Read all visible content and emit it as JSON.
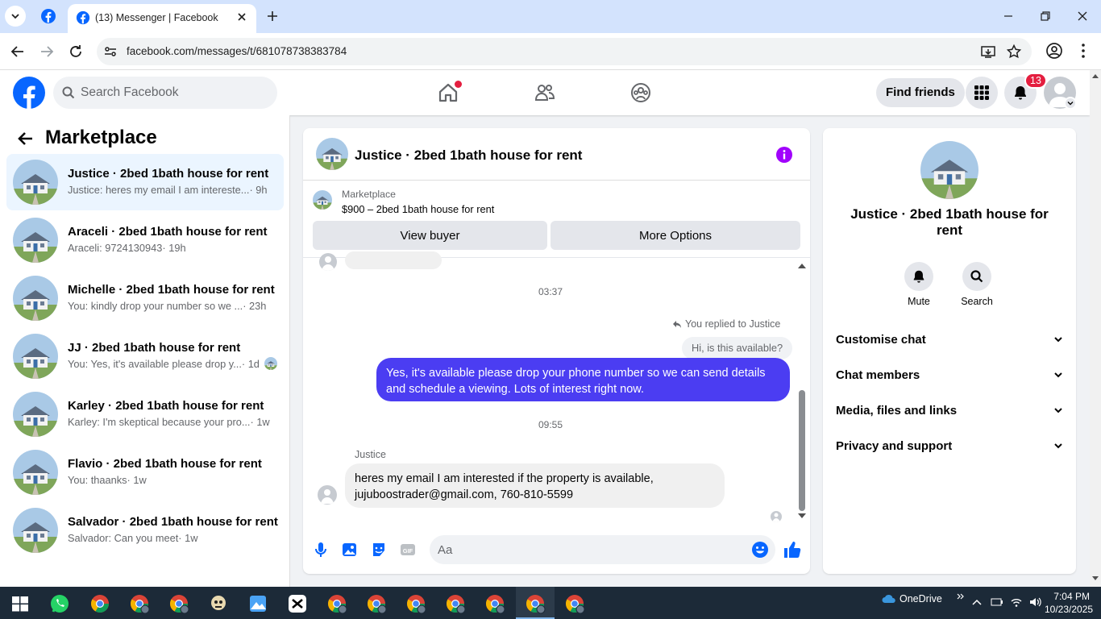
{
  "browser": {
    "tab_title": "(13) Messenger | Facebook",
    "url": "facebook.com/messages/t/681078738383784"
  },
  "fb_header": {
    "search_placeholder": "Search Facebook",
    "find_friends_label": "Find friends",
    "notification_count": "13",
    "nav_icons": [
      "home-icon",
      "friends-icon",
      "groups-icon"
    ],
    "accent_color": "#0866ff"
  },
  "marketplace": {
    "title": "Marketplace",
    "conversations": [
      {
        "name": "Justice · 2bed 1bath house for rent",
        "preview": "Justice: heres my email I am intereste...",
        "time": "· 9h",
        "active": true
      },
      {
        "name": "Araceli · 2bed 1bath house for rent",
        "preview": "Araceli: 9724130943",
        "time": "· 19h"
      },
      {
        "name": "Michelle · 2bed 1bath house for rent",
        "preview": "You: kindly drop your number so we ...",
        "time": "· 23h"
      },
      {
        "name": "JJ · 2bed 1bath house for rent",
        "preview": "You: Yes, it's available please drop y...",
        "time": "· 1d"
      },
      {
        "name": "Karley · 2bed 1bath house for rent",
        "preview": "Karley: I'm skeptical because your pro...",
        "time": "· 1w"
      },
      {
        "name": "Flavio · 2bed 1bath house for rent",
        "preview": "You: thaanks",
        "time": "· 1w"
      },
      {
        "name": "Salvador · 2bed 1bath house for rent",
        "preview": "Salvador: Can you meet",
        "time": "· 1w"
      }
    ]
  },
  "chat": {
    "title": "Justice · 2bed 1bath house for rent",
    "listing_label": "Marketplace",
    "listing_price": "$900 – 2bed 1bath house for rent",
    "view_buyer_label": "View buyer",
    "more_options_label": "More Options",
    "time_1": "03:37",
    "replied_label": "You replied to Justice",
    "quoted_message": "Hi, is this available?",
    "my_message": "Yes, it's available please drop your phone number so we can send details and schedule a viewing. Lots of interest right now.",
    "time_2": "09:55",
    "sender_name": "Justice",
    "their_message_line1": "heres my email I am interested if the property is available,",
    "their_message_line2": "jujuboostrader@gmail.com, 760-810-5599",
    "input_placeholder": "Aa",
    "my_bubble_color": "#4b3df2"
  },
  "details": {
    "name": "Justice · 2bed 1bath house for rent",
    "mute_label": "Mute",
    "search_label": "Search",
    "sections": [
      "Customise chat",
      "Chat members",
      "Media, files and links",
      "Privacy and support"
    ]
  },
  "taskbar": {
    "onedrive_label": "OneDrive",
    "time": "7:04 PM",
    "date": "10/23/2025"
  }
}
